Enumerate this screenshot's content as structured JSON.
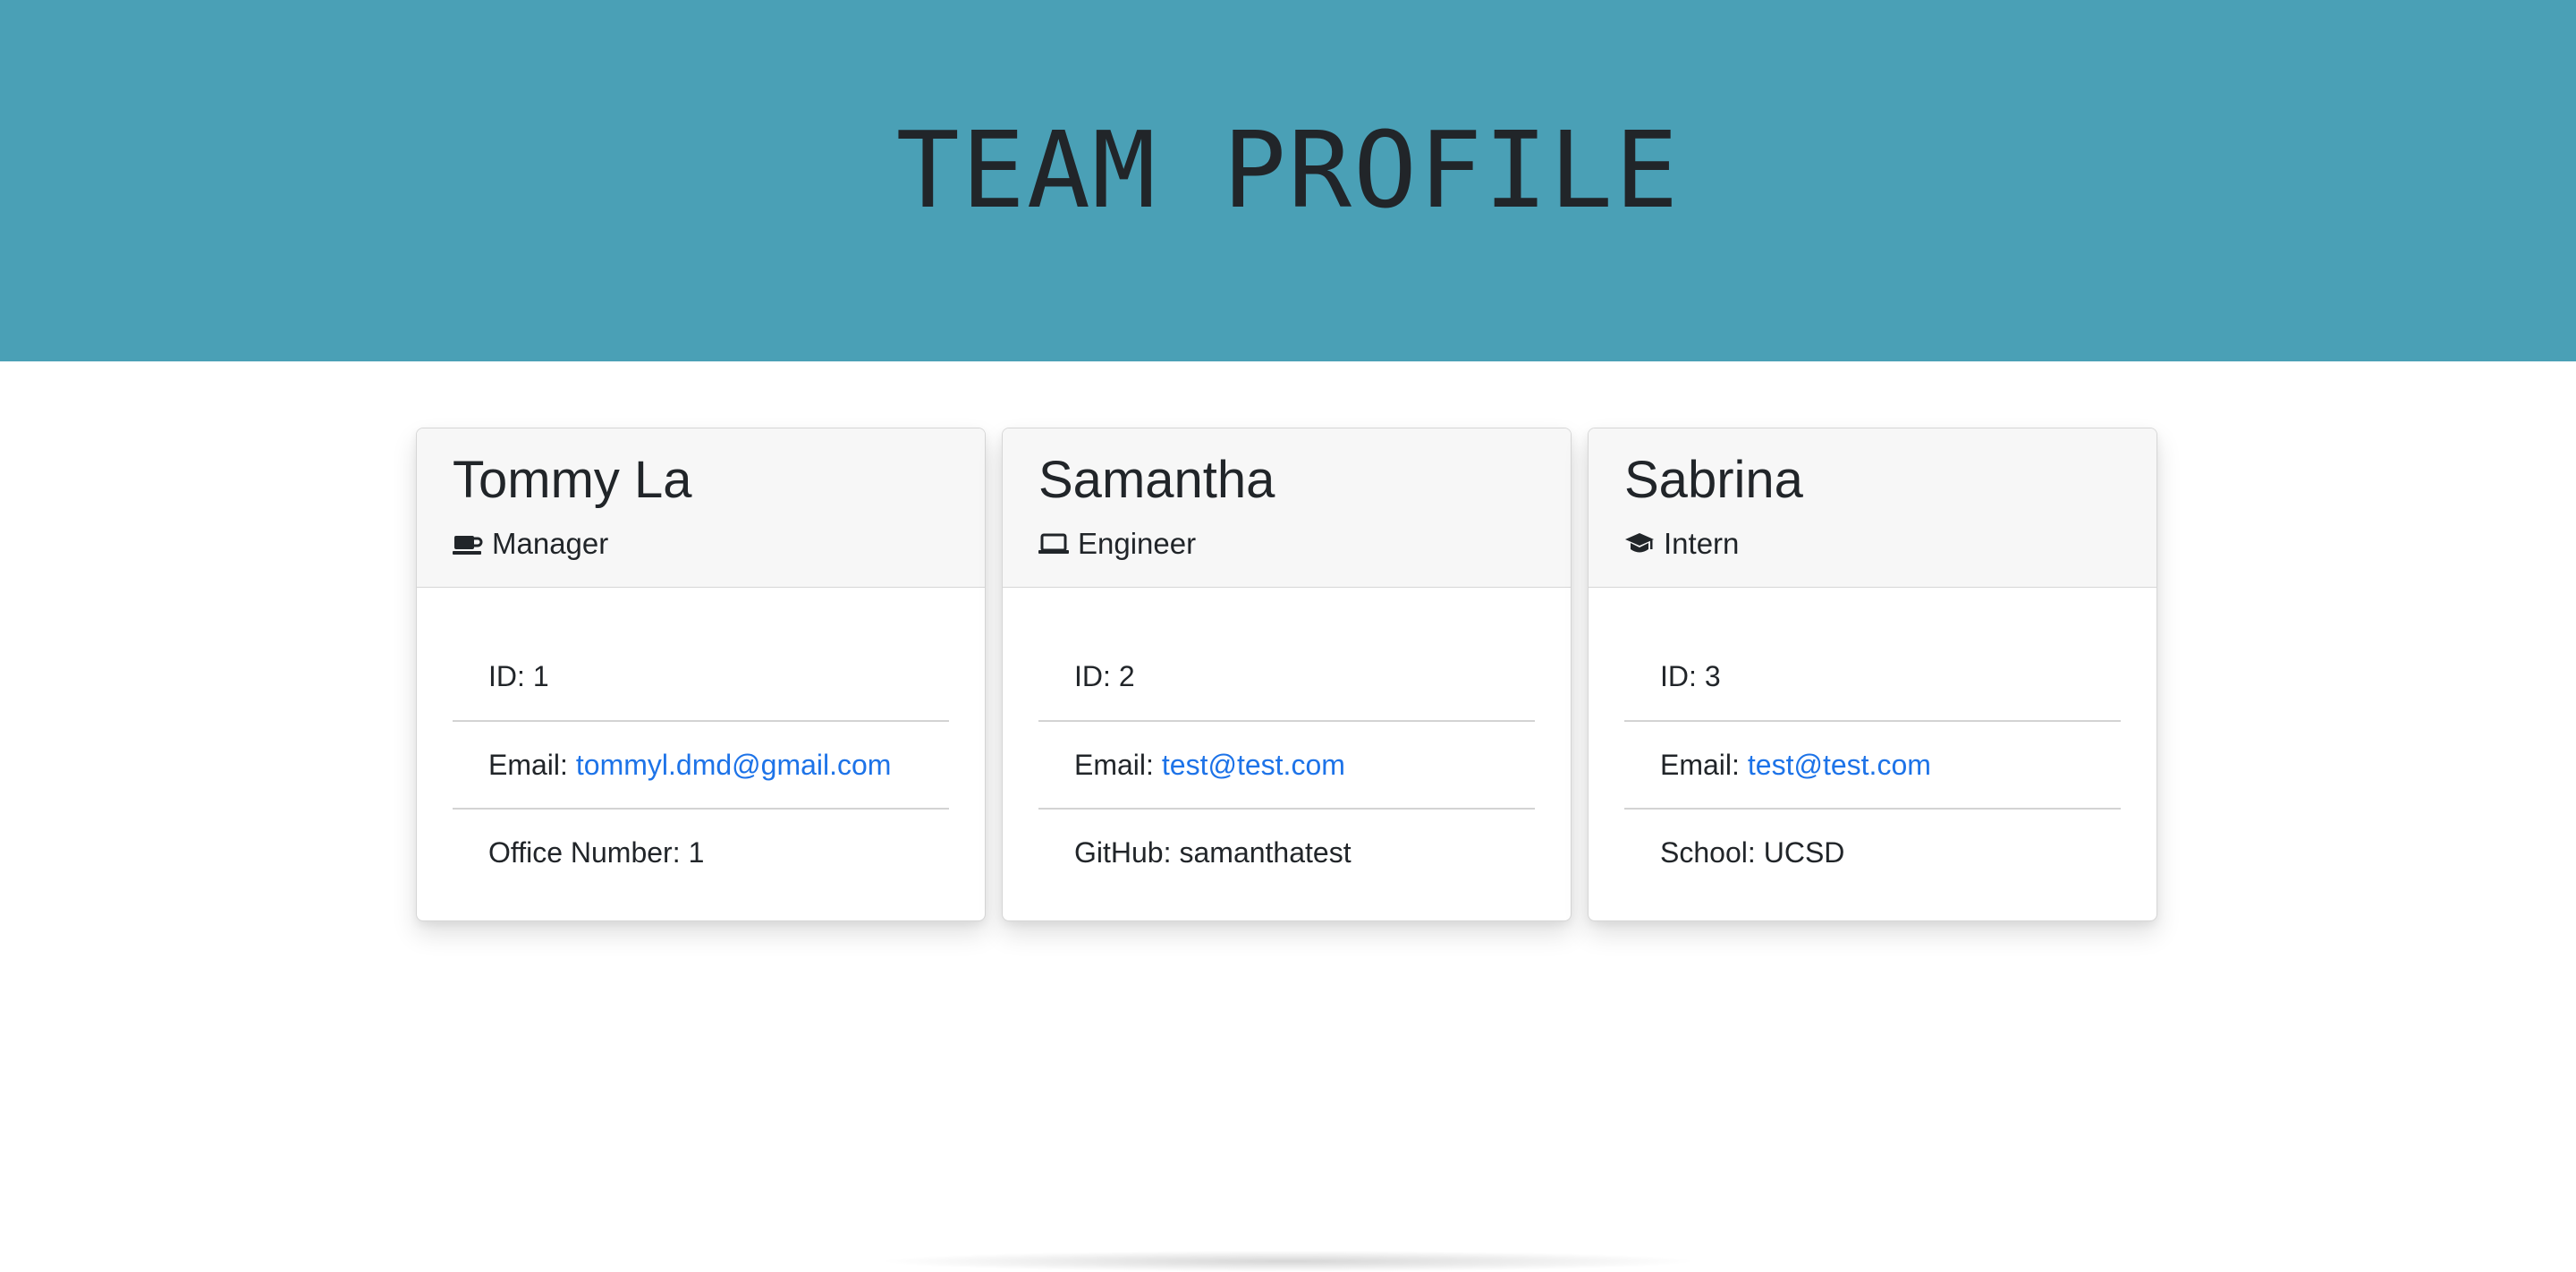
{
  "header": {
    "title": "TEAM PROFILE",
    "background_color": "#4aa0b6"
  },
  "cards": [
    {
      "name": "Tommy La",
      "role": "Manager",
      "icon": "coffee-icon",
      "details": [
        {
          "label": "ID:",
          "value": "1",
          "type": "text"
        },
        {
          "label": "Email:",
          "value": "tommyl.dmd@gmail.com",
          "type": "link"
        },
        {
          "label": "Office Number:",
          "value": "1",
          "type": "text"
        }
      ]
    },
    {
      "name": "Samantha",
      "role": "Engineer",
      "icon": "laptop-icon",
      "details": [
        {
          "label": "ID:",
          "value": "2",
          "type": "text"
        },
        {
          "label": "Email:",
          "value": "test@test.com",
          "type": "link"
        },
        {
          "label": "GitHub:",
          "value": "samanthatest",
          "type": "text"
        }
      ]
    },
    {
      "name": "Sabrina",
      "role": "Intern",
      "icon": "graduation-cap-icon",
      "details": [
        {
          "label": "ID:",
          "value": "3",
          "type": "text"
        },
        {
          "label": "Email:",
          "value": "test@test.com",
          "type": "link"
        },
        {
          "label": "School:",
          "value": "UCSD",
          "type": "text"
        }
      ]
    }
  ],
  "colors": {
    "link": "#1d73e8",
    "text": "#212529"
  }
}
